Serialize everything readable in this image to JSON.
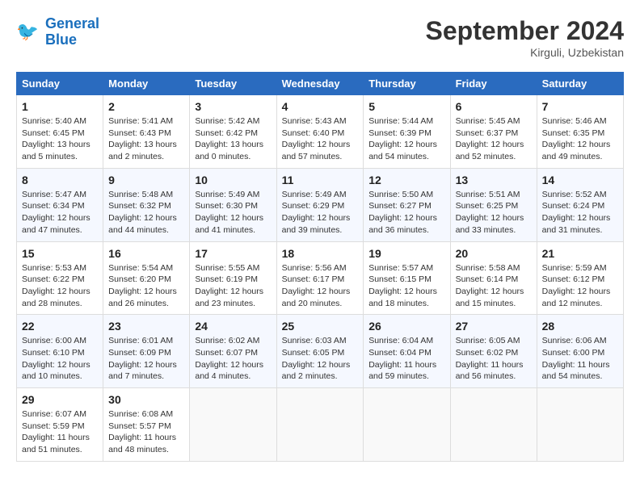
{
  "header": {
    "logo_line1": "General",
    "logo_line2": "Blue",
    "month": "September 2024",
    "location": "Kirguli, Uzbekistan"
  },
  "columns": [
    "Sunday",
    "Monday",
    "Tuesday",
    "Wednesday",
    "Thursday",
    "Friday",
    "Saturday"
  ],
  "weeks": [
    [
      {
        "day": "1",
        "detail": "Sunrise: 5:40 AM\nSunset: 6:45 PM\nDaylight: 13 hours\nand 5 minutes."
      },
      {
        "day": "2",
        "detail": "Sunrise: 5:41 AM\nSunset: 6:43 PM\nDaylight: 13 hours\nand 2 minutes."
      },
      {
        "day": "3",
        "detail": "Sunrise: 5:42 AM\nSunset: 6:42 PM\nDaylight: 13 hours\nand 0 minutes."
      },
      {
        "day": "4",
        "detail": "Sunrise: 5:43 AM\nSunset: 6:40 PM\nDaylight: 12 hours\nand 57 minutes."
      },
      {
        "day": "5",
        "detail": "Sunrise: 5:44 AM\nSunset: 6:39 PM\nDaylight: 12 hours\nand 54 minutes."
      },
      {
        "day": "6",
        "detail": "Sunrise: 5:45 AM\nSunset: 6:37 PM\nDaylight: 12 hours\nand 52 minutes."
      },
      {
        "day": "7",
        "detail": "Sunrise: 5:46 AM\nSunset: 6:35 PM\nDaylight: 12 hours\nand 49 minutes."
      }
    ],
    [
      {
        "day": "8",
        "detail": "Sunrise: 5:47 AM\nSunset: 6:34 PM\nDaylight: 12 hours\nand 47 minutes."
      },
      {
        "day": "9",
        "detail": "Sunrise: 5:48 AM\nSunset: 6:32 PM\nDaylight: 12 hours\nand 44 minutes."
      },
      {
        "day": "10",
        "detail": "Sunrise: 5:49 AM\nSunset: 6:30 PM\nDaylight: 12 hours\nand 41 minutes."
      },
      {
        "day": "11",
        "detail": "Sunrise: 5:49 AM\nSunset: 6:29 PM\nDaylight: 12 hours\nand 39 minutes."
      },
      {
        "day": "12",
        "detail": "Sunrise: 5:50 AM\nSunset: 6:27 PM\nDaylight: 12 hours\nand 36 minutes."
      },
      {
        "day": "13",
        "detail": "Sunrise: 5:51 AM\nSunset: 6:25 PM\nDaylight: 12 hours\nand 33 minutes."
      },
      {
        "day": "14",
        "detail": "Sunrise: 5:52 AM\nSunset: 6:24 PM\nDaylight: 12 hours\nand 31 minutes."
      }
    ],
    [
      {
        "day": "15",
        "detail": "Sunrise: 5:53 AM\nSunset: 6:22 PM\nDaylight: 12 hours\nand 28 minutes."
      },
      {
        "day": "16",
        "detail": "Sunrise: 5:54 AM\nSunset: 6:20 PM\nDaylight: 12 hours\nand 26 minutes."
      },
      {
        "day": "17",
        "detail": "Sunrise: 5:55 AM\nSunset: 6:19 PM\nDaylight: 12 hours\nand 23 minutes."
      },
      {
        "day": "18",
        "detail": "Sunrise: 5:56 AM\nSunset: 6:17 PM\nDaylight: 12 hours\nand 20 minutes."
      },
      {
        "day": "19",
        "detail": "Sunrise: 5:57 AM\nSunset: 6:15 PM\nDaylight: 12 hours\nand 18 minutes."
      },
      {
        "day": "20",
        "detail": "Sunrise: 5:58 AM\nSunset: 6:14 PM\nDaylight: 12 hours\nand 15 minutes."
      },
      {
        "day": "21",
        "detail": "Sunrise: 5:59 AM\nSunset: 6:12 PM\nDaylight: 12 hours\nand 12 minutes."
      }
    ],
    [
      {
        "day": "22",
        "detail": "Sunrise: 6:00 AM\nSunset: 6:10 PM\nDaylight: 12 hours\nand 10 minutes."
      },
      {
        "day": "23",
        "detail": "Sunrise: 6:01 AM\nSunset: 6:09 PM\nDaylight: 12 hours\nand 7 minutes."
      },
      {
        "day": "24",
        "detail": "Sunrise: 6:02 AM\nSunset: 6:07 PM\nDaylight: 12 hours\nand 4 minutes."
      },
      {
        "day": "25",
        "detail": "Sunrise: 6:03 AM\nSunset: 6:05 PM\nDaylight: 12 hours\nand 2 minutes."
      },
      {
        "day": "26",
        "detail": "Sunrise: 6:04 AM\nSunset: 6:04 PM\nDaylight: 11 hours\nand 59 minutes."
      },
      {
        "day": "27",
        "detail": "Sunrise: 6:05 AM\nSunset: 6:02 PM\nDaylight: 11 hours\nand 56 minutes."
      },
      {
        "day": "28",
        "detail": "Sunrise: 6:06 AM\nSunset: 6:00 PM\nDaylight: 11 hours\nand 54 minutes."
      }
    ],
    [
      {
        "day": "29",
        "detail": "Sunrise: 6:07 AM\nSunset: 5:59 PM\nDaylight: 11 hours\nand 51 minutes."
      },
      {
        "day": "30",
        "detail": "Sunrise: 6:08 AM\nSunset: 5:57 PM\nDaylight: 11 hours\nand 48 minutes."
      },
      {
        "day": "",
        "detail": ""
      },
      {
        "day": "",
        "detail": ""
      },
      {
        "day": "",
        "detail": ""
      },
      {
        "day": "",
        "detail": ""
      },
      {
        "day": "",
        "detail": ""
      }
    ]
  ]
}
